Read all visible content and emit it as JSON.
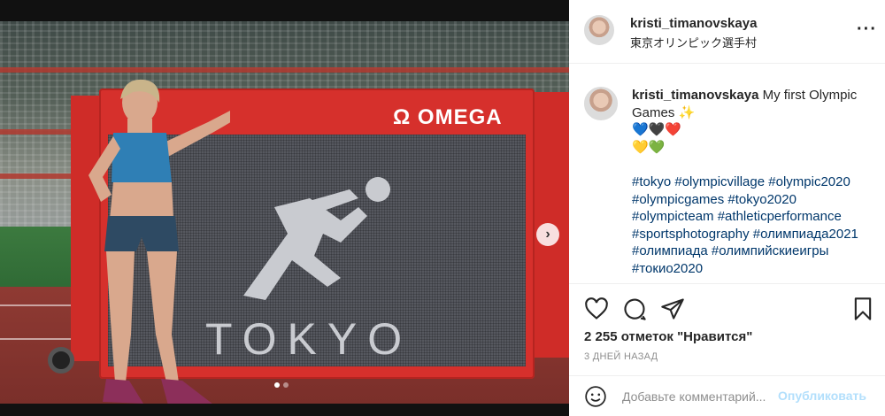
{
  "post": {
    "username": "kristi_timanovskaya",
    "location": "東京オリンピック選手村",
    "caption_line1": "My first Olympic Games ✨",
    "caption_line2": "💙🖤❤️",
    "caption_line3": "💛💚",
    "hashtags": [
      "#tokyo",
      "#olympicvillage",
      "#olympic2020",
      "#olympicgames",
      "#tokyo2020",
      "#olympicteam",
      "#athleticperformance",
      "#sportsphotography",
      "#олимпиада2021",
      "#олимпиада",
      "#олимпийскиеигры",
      "#токио2020"
    ],
    "likes_text": "2 255 отметок \"Нравится\"",
    "date_text": "3 ДНЕЙ НАЗАД"
  },
  "photo": {
    "scoreboard_brand": "Ω OMEGA",
    "scoreboard_text": "TOKYO",
    "carousel_total": 2,
    "carousel_current": 1
  },
  "comment": {
    "placeholder": "Добавьте комментарий...",
    "post_label": "Опубликовать"
  },
  "icons": {
    "more": "more-options-icon",
    "like": "heart-icon",
    "comment": "comment-bubble-icon",
    "share": "paper-plane-icon",
    "save": "bookmark-icon",
    "emoji": "smiley-icon",
    "next": "chevron-right-icon"
  },
  "colors": {
    "hashtag": "#00376b",
    "post_button_disabled": "#b2dffc",
    "scoreboard_red": "#d6302c"
  }
}
